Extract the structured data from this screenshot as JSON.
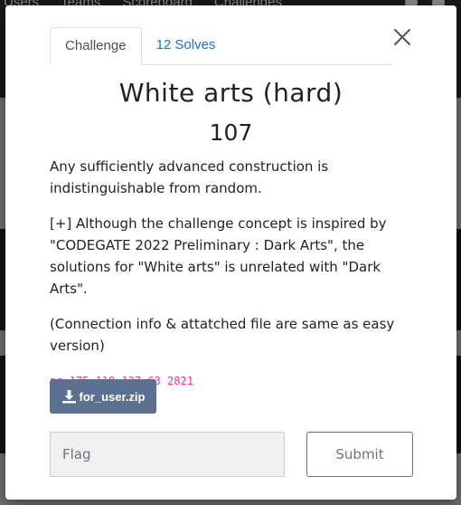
{
  "background": {
    "nav_links": [
      "Users",
      "Teams",
      "Scoreboard",
      "Challenges"
    ]
  },
  "modal": {
    "tabs": [
      {
        "label": "Challenge",
        "active": true
      },
      {
        "label": "12 Solves",
        "active": false
      }
    ],
    "title": "White arts (hard)",
    "points": "107",
    "description": [
      "Any sufficiently advanced construction is indistinguishable from random.",
      "[+] Although the challenge concept is inspired by \"CODEGATE 2022 Preliminary : Dark Arts\", the solutions for \"White arts\" is unrelated with \"Dark Arts\".",
      "(Connection info & attatched file are same as easy version)"
    ],
    "connection": "nc 175.118.127.63 2821",
    "download_label": "for_user.zip",
    "flag_placeholder": "Flag",
    "flag_value": "",
    "submit_label": "Submit"
  },
  "colors": {
    "accent_link": "#1a73c8",
    "download_button": "#5c708f",
    "code_text": "#e83e8c"
  },
  "icons": {
    "close": "close-icon",
    "download": "download-icon"
  }
}
